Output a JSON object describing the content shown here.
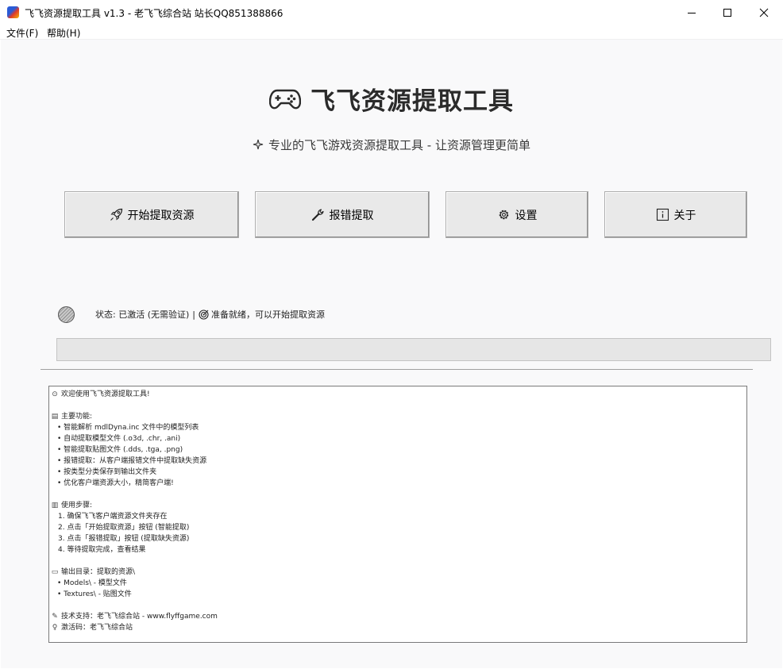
{
  "window": {
    "title": "飞飞资源提取工具 v1.3 - 老飞飞综合站 站长QQ851388866",
    "controls": [
      "minimize",
      "maximize",
      "close"
    ]
  },
  "menu": [
    {
      "label": "文件(F)"
    },
    {
      "label": "帮助(H)"
    }
  ],
  "header": {
    "icon": "gamepad-icon",
    "title": "飞飞资源提取工具",
    "subtitle_icon": "sparkle-icon",
    "subtitle": "专业的飞飞游戏资源提取工具 - 让资源管理更简单"
  },
  "buttons": [
    {
      "label": "开始提取资源",
      "icon": "rocket-icon"
    },
    {
      "label": "报错提取",
      "icon": "wrench-icon"
    },
    {
      "label": "设置",
      "icon": "gear-icon"
    },
    {
      "label": "关于",
      "icon": "info-icon"
    }
  ],
  "status": {
    "activation": "状态: 已激活 (无需验证)",
    "separator": "|",
    "ready": "准备就绪，可以开始提取资源"
  },
  "progress": {
    "value": 0
  },
  "log": {
    "welcome": "欢迎使用飞飞资源提取工具!",
    "features_title": "主要功能:",
    "features": [
      "• 智能解析 mdlDyna.inc 文件中的模型列表",
      "• 自动提取模型文件 (.o3d, .chr, .ani)",
      "• 智能提取贴图文件 (.dds, .tga, .png)",
      "• 报错提取：从客户端报错文件中提取缺失资源",
      "• 按类型分类保存到输出文件夹",
      "• 优化客户端资源大小，精简客户端!"
    ],
    "steps_title": "使用步骤:",
    "steps": [
      "1. 确保飞飞客户端资源文件夹存在",
      "2. 点击「开始提取资源」按钮 (智能提取)",
      "3. 点击「报错提取」按钮 (提取缺失资源)",
      "4. 等待提取完成，查看结果"
    ],
    "output_title": "输出目录：提取的资源\\",
    "outputs": [
      "• Models\\ - 模型文件",
      "• Textures\\ - 贴图文件"
    ],
    "support": "技术支持：老飞飞综合站 - www.flyffgame.com",
    "activation_code": "激活码：老飞飞综合站"
  }
}
